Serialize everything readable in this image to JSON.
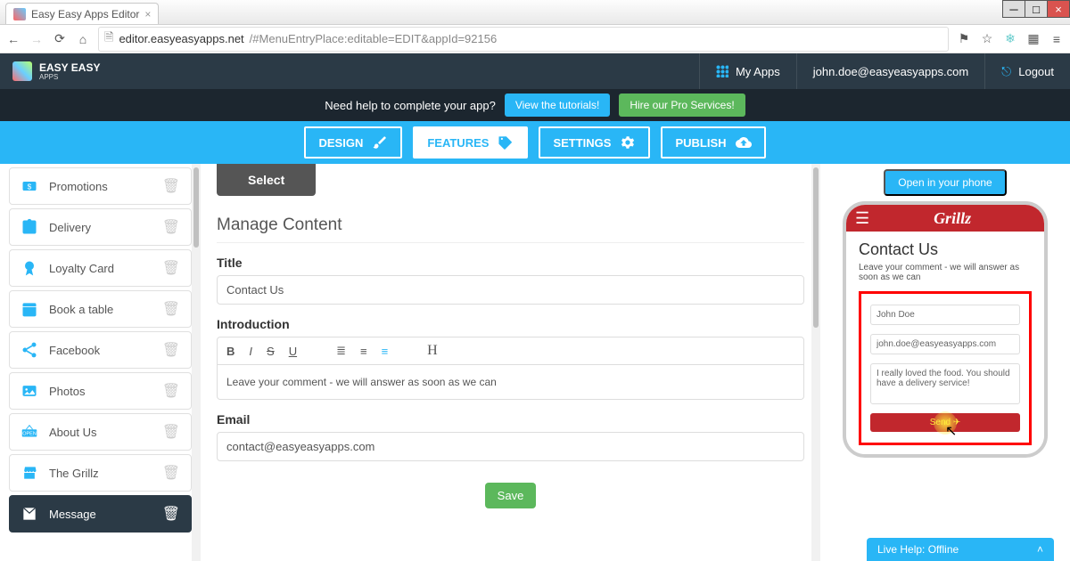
{
  "browser": {
    "tab": {
      "title": "Easy Easy Apps Editor"
    },
    "url_host": "editor.easyeasyapps.net",
    "url_path": "/#MenuEntryPlace:editable=EDIT&appId=92156"
  },
  "header": {
    "brand_line1": "EASY EASY",
    "brand_line2": "APPS",
    "my_apps": "My Apps",
    "email": "john.doe@easyeasyapps.com",
    "logout": "Logout"
  },
  "helpbar": {
    "prompt": "Need help to complete your app?",
    "tutorials": "View the tutorials!",
    "pro": "Hire our Pro Services!"
  },
  "nav": {
    "design": "DESIGN",
    "features": "FEATURES",
    "settings": "SETTINGS",
    "publish": "PUBLISH"
  },
  "sidebar": {
    "items": [
      {
        "icon": "$",
        "label": "Promotions"
      },
      {
        "icon": "clip",
        "label": "Delivery"
      },
      {
        "icon": "badge",
        "label": "Loyalty Card"
      },
      {
        "icon": "cal",
        "label": "Book a table"
      },
      {
        "icon": "share",
        "label": "Facebook"
      },
      {
        "icon": "img",
        "label": "Photos"
      },
      {
        "icon": "open",
        "label": "About Us"
      },
      {
        "icon": "store",
        "label": "The Grillz"
      },
      {
        "icon": "mail",
        "label": "Message"
      }
    ]
  },
  "main": {
    "select": "Select",
    "heading": "Manage Content",
    "title_label": "Title",
    "title_value": "Contact Us",
    "intro_label": "Introduction",
    "intro_value": "Leave your comment - we will answer as soon as we can",
    "email_label": "Email",
    "email_value": "contact@easyeasyapps.com",
    "save": "Save"
  },
  "preview": {
    "open": "Open in your phone",
    "app_name": "Grillz",
    "page_title": "Contact Us",
    "page_sub": "Leave your comment - we will answer as soon as we can",
    "form_name": "John Doe",
    "form_email": "john.doe@easyeasyapps.com",
    "form_msg": "I really loved the food. You should have a delivery service!",
    "send": "Send"
  },
  "live_help": {
    "label": "Live Help: Offline"
  }
}
